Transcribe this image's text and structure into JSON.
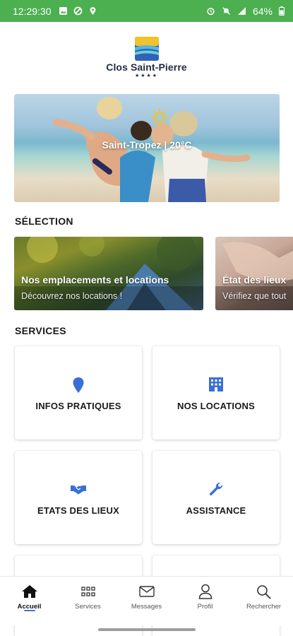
{
  "status_bar": {
    "time": "12:29:30",
    "battery": "64%",
    "color": "#4caf50"
  },
  "brand": {
    "name": "Clos Saint-Pierre",
    "stars": "★★★★"
  },
  "hero": {
    "caption": "Saint-Tropez | 20°C"
  },
  "selection": {
    "title": "SÉLECTION",
    "cards": [
      {
        "title": "Nos emplacements et locations",
        "subtitle": "Découvrez nos locations !"
      },
      {
        "title": "État des lieux",
        "subtitle": "Vérifiez que tout"
      }
    ]
  },
  "services": {
    "title": "SERVICES",
    "items": [
      {
        "label": "INFOS PRATIQUES",
        "icon": "location-pin-icon"
      },
      {
        "label": "NOS LOCATIONS",
        "icon": "building-icon"
      },
      {
        "label": "ETATS DES LIEUX",
        "icon": "handshake-icon"
      },
      {
        "label": "ASSISTANCE",
        "icon": "wrench-icon"
      }
    ],
    "icon_color": "#3b6fd6"
  },
  "bottom_nav": {
    "items": [
      {
        "label": "Accueil",
        "icon": "home-icon",
        "active": true
      },
      {
        "label": "Services",
        "icon": "grid-icon"
      },
      {
        "label": "Messages",
        "icon": "envelope-icon"
      },
      {
        "label": "Profil",
        "icon": "user-icon"
      },
      {
        "label": "Rechercher",
        "icon": "search-icon"
      }
    ]
  }
}
